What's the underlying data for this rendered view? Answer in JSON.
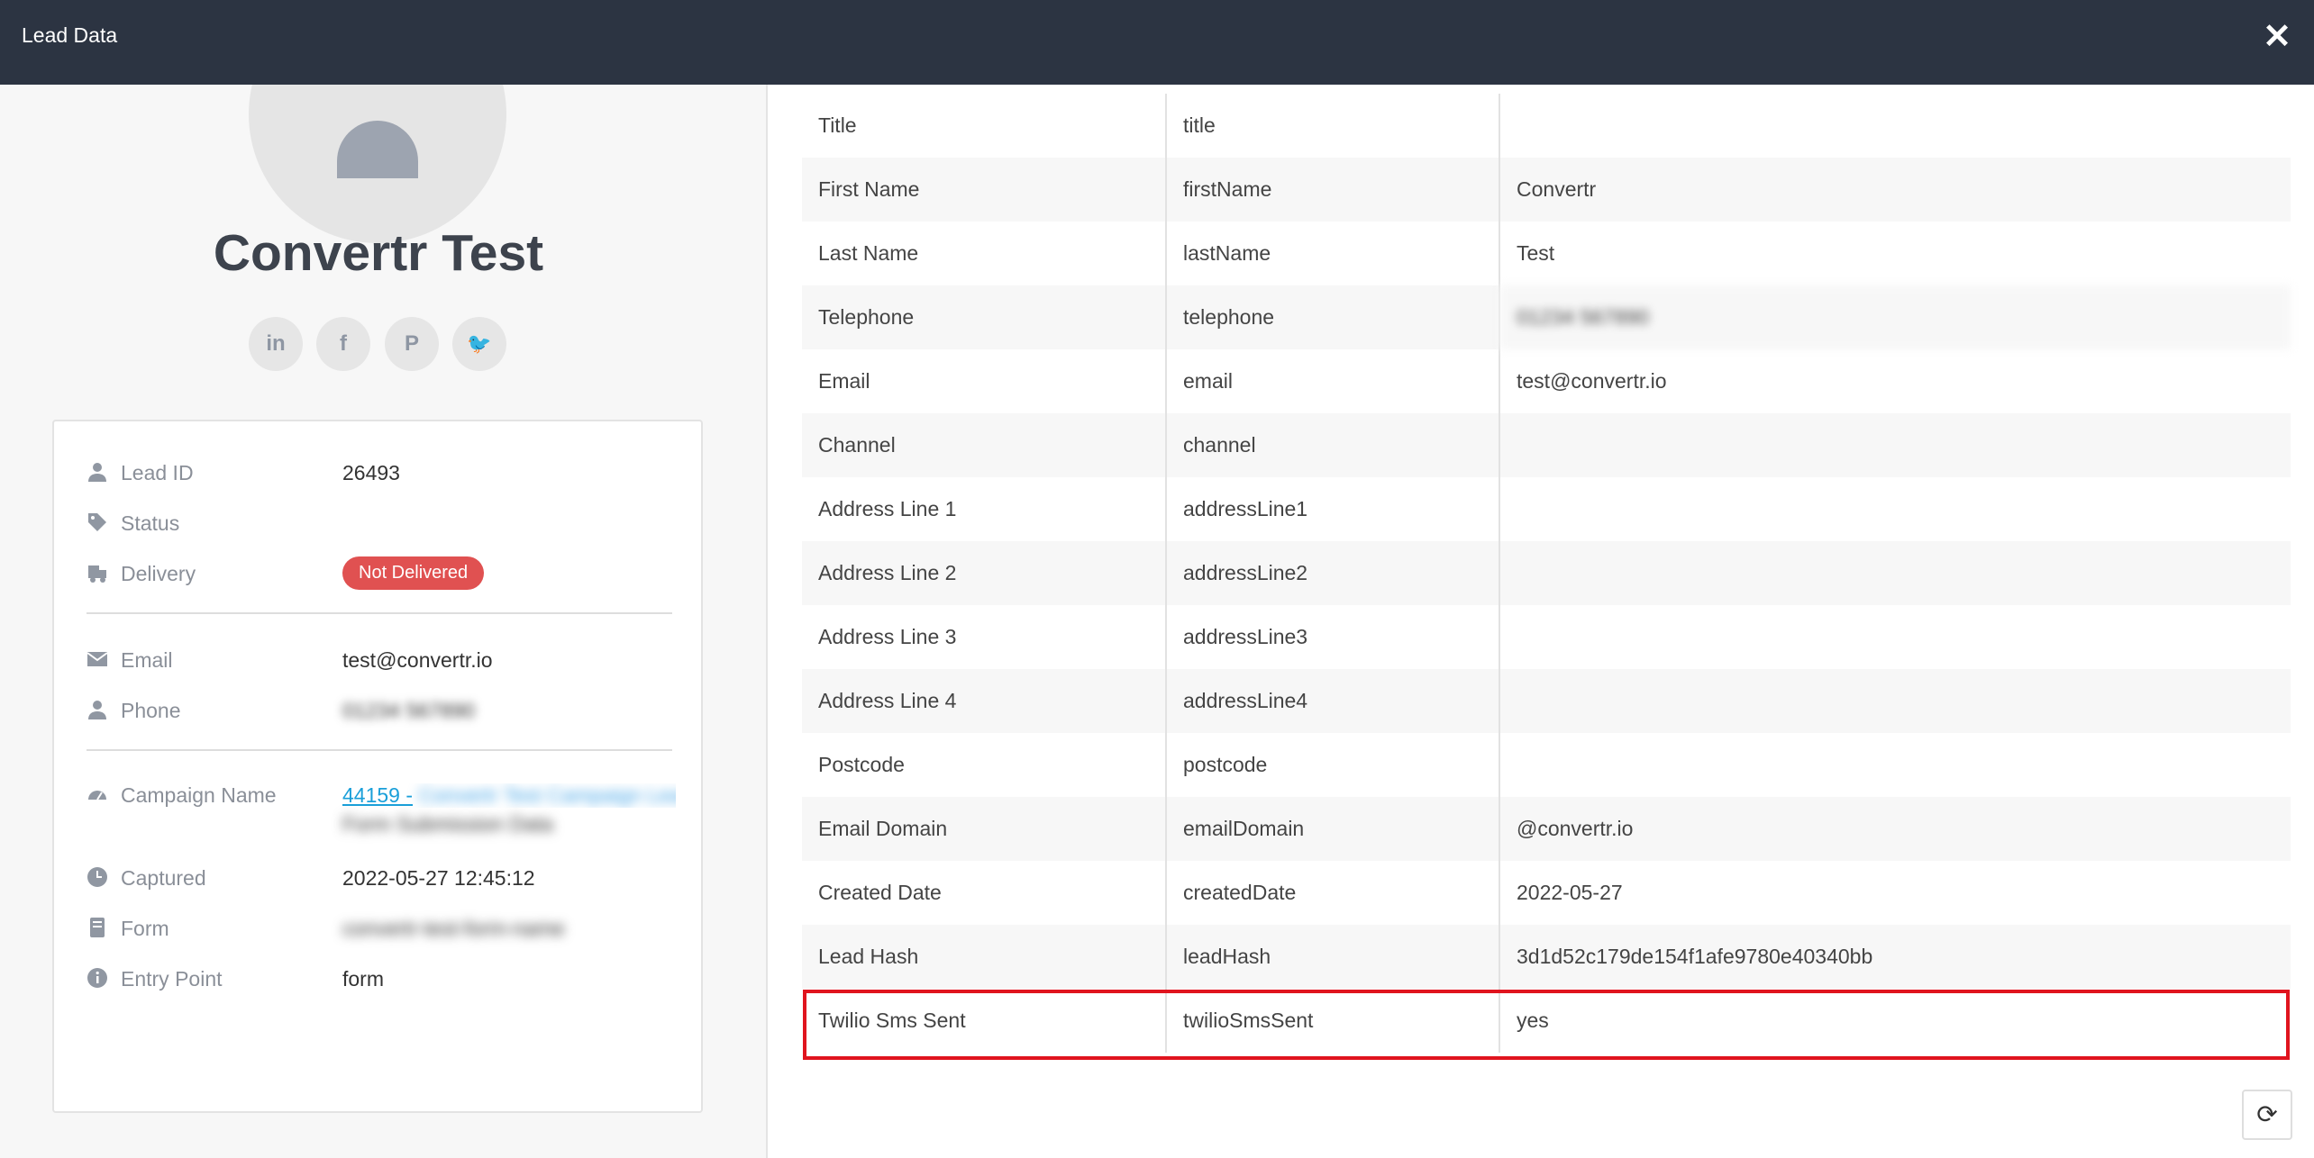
{
  "modal": {
    "title": "Lead Data",
    "close_symbol": "✕"
  },
  "profile": {
    "name": "Convertr Test",
    "social": [
      {
        "name": "linkedin-icon",
        "glyph": "in"
      },
      {
        "name": "facebook-icon",
        "glyph": "f"
      },
      {
        "name": "pinterest-icon",
        "glyph": "P"
      },
      {
        "name": "twitter-icon",
        "glyph": "🐦"
      }
    ]
  },
  "details": {
    "lead_id_label": "Lead ID",
    "lead_id": "26493",
    "status_label": "Status",
    "delivery_label": "Delivery",
    "delivery_badge": "Not Delivered",
    "email_label": "Email",
    "email": "test@convertr.io",
    "phone_label": "Phone",
    "phone": "01234 567890",
    "campaign_label": "Campaign Name",
    "campaign_id": "44159 -",
    "campaign_rest": "Convertr Test Campaign Lead Generation",
    "campaign_rest2": "Form Submission Data",
    "captured_label": "Captured",
    "captured": "2022-05-27 12:45:12",
    "form_label": "Form",
    "form_value": "convertr-test-form-name",
    "entry_label": "Entry Point",
    "entry": "form"
  },
  "table": {
    "rows": [
      {
        "label": "Title",
        "key": "title",
        "value": ""
      },
      {
        "label": "First Name",
        "key": "firstName",
        "value": "Convertr"
      },
      {
        "label": "Last Name",
        "key": "lastName",
        "value": "Test"
      },
      {
        "label": "Telephone",
        "key": "telephone",
        "value": "01234 567890"
      },
      {
        "label": "Email",
        "key": "email",
        "value": "test@convertr.io"
      },
      {
        "label": "Channel",
        "key": "channel",
        "value": ""
      },
      {
        "label": "Address Line 1",
        "key": "addressLine1",
        "value": ""
      },
      {
        "label": "Address Line 2",
        "key": "addressLine2",
        "value": ""
      },
      {
        "label": "Address Line 3",
        "key": "addressLine3",
        "value": ""
      },
      {
        "label": "Address Line 4",
        "key": "addressLine4",
        "value": ""
      },
      {
        "label": "Postcode",
        "key": "postcode",
        "value": ""
      },
      {
        "label": "Email Domain",
        "key": "emailDomain",
        "value": "@convertr.io"
      },
      {
        "label": "Created Date",
        "key": "createdDate",
        "value": "2022-05-27"
      },
      {
        "label": "Lead Hash",
        "key": "leadHash",
        "value": "3d1d52c179de154f1afe9780e40340bb"
      },
      {
        "label": "Twilio Sms Sent",
        "key": "twilioSmsSent",
        "value": "yes"
      }
    ]
  },
  "refresh_symbol": "⟳",
  "colors": {
    "header": "#2c3442",
    "badge": "#e05151",
    "highlight": "#e0141e",
    "link": "#1a9fd9"
  }
}
